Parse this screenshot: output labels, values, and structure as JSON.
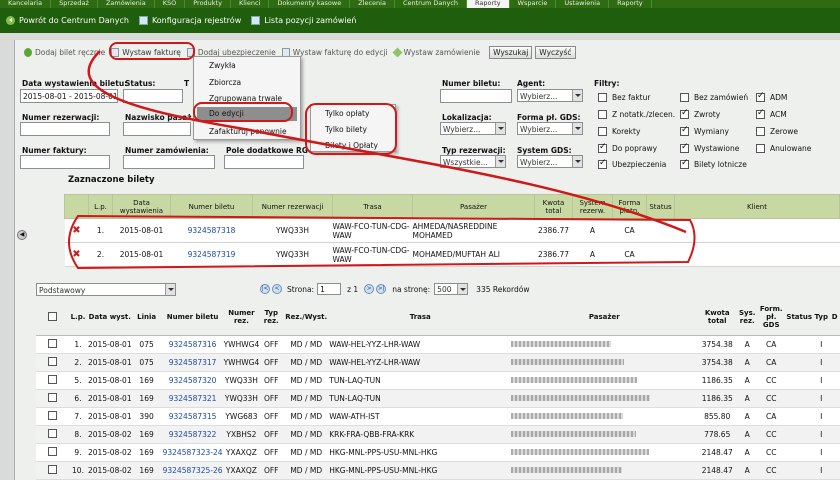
{
  "top_nav": {
    "tabs": [
      "Kancelaria",
      "Sprzedaż",
      "Zamówienia",
      "KSO",
      "Produkty",
      "Klienci",
      "Dokumenty kasowe",
      "Zlecenia",
      "Centrum Danych",
      "Raporty",
      "Wsparcie",
      "Ustawienia",
      "Raporty"
    ],
    "active_index": 9
  },
  "sub_nav": {
    "back": "Powrót do Centrum Danych",
    "config": "Konfiguracja rejestrów",
    "list": "Lista pozycji zamówień"
  },
  "toolbar": {
    "add_ticket": "Dodaj bilet ręcznie",
    "issue_invoice": "Wystaw fakturę",
    "add_insurance": "Dodaj ubezpieczenie",
    "issue_invoice_edit": "Wystaw fakturę do edycji",
    "issue_order": "Wystaw zamówienie",
    "search": "Wyszukaj",
    "clear": "Wyczyść"
  },
  "filters": {
    "issue_date_label": "Data wystawienia biletu:",
    "issue_date_value": "2015-08-01 - 2015-08-01",
    "status_label": "Status:",
    "t_label": "T",
    "ticket_number_label": "Numer biletu:",
    "agent_label": "Agent:",
    "agent_value": "Wybierz...",
    "reservation_label": "Numer rezerwacji:",
    "passenger_label": "Nazwisko pasaż",
    "location_label": "Lokalizacja:",
    "location_value": "Wybierz...",
    "gds_form_label": "Forma pł. GDS:",
    "gds_form_value": "Wybierz...",
    "invoice_label": "Numer faktury:",
    "order_label": "Numer zamówienia:",
    "extra_field_label": "Pole dodatkowe RG",
    "reservation_type_label": "Typ rezerwacji:",
    "reservation_type_value": "Wszystkie...",
    "gds_system_label": "System GDS:",
    "gds_system_value": "Wybierz..."
  },
  "checkbox_filters": {
    "title": "Filtry:",
    "items": [
      {
        "label": "Bez faktur",
        "checked": false
      },
      {
        "label": "Bez zamówień",
        "checked": false
      },
      {
        "label": "ADM",
        "checked": true
      },
      {
        "label": "Z notatk./zlecen.",
        "checked": false
      },
      {
        "label": "Zwroty",
        "checked": true
      },
      {
        "label": "ACM",
        "checked": true
      },
      {
        "label": "Korekty",
        "checked": false
      },
      {
        "label": "Wymiany",
        "checked": true
      },
      {
        "label": "Zerowe",
        "checked": false
      },
      {
        "label": "Do poprawy",
        "checked": true
      },
      {
        "label": "Wystawione",
        "checked": true
      },
      {
        "label": "Anulowane",
        "checked": false
      },
      {
        "label": "Ubezpieczenia",
        "checked": true
      },
      {
        "label": "Bilety lotnicze",
        "checked": true
      }
    ]
  },
  "dropdown_menu": {
    "items": [
      "Zwykła",
      "Zbiorcza",
      "Zgrupowana trwale",
      "Do edycji",
      "Zafakturuj ponownie"
    ],
    "highlighted": "Do edycji"
  },
  "submenu": {
    "items": [
      "Tylko opłaty",
      "Tylko bilety",
      "Bilety i Opłaty"
    ]
  },
  "selected": {
    "title": "Zaznaczone bilety",
    "headers": [
      "L.p.",
      "Data wystawienia",
      "Numer biletu",
      "Numer rezerwacji",
      "Trasa",
      "Pasażer",
      "Kwota total",
      "System rezerw.",
      "Forma płatn.",
      "Status",
      "Klient"
    ],
    "rows": [
      {
        "lp": "1.",
        "date": "2015-08-01",
        "ticket": "9324587318",
        "res": "YWQ33H",
        "route": "WAW-FCO-TUN-CDG-WAW",
        "passenger": "AHMEDA/NASREDDINE MOHAMED",
        "amount": "2386.77",
        "sys": "A",
        "form": "CA"
      },
      {
        "lp": "2.",
        "date": "2015-08-01",
        "ticket": "9324587319",
        "res": "YWQ33H",
        "route": "WAW-FCO-TUN-CDG-WAW",
        "passenger": "MOHAMED/MUFTAH ALI",
        "amount": "2386.77",
        "sys": "A",
        "form": "CA"
      }
    ]
  },
  "pager": {
    "view": "Podstawowy",
    "page_label": "Strona:",
    "page": "1",
    "of": "z 1",
    "per_page_label": "na stronę:",
    "per_page": "500",
    "records": "335 Rekordów"
  },
  "main_table": {
    "headers": [
      "L.p.",
      "Data wyst.",
      "Linia",
      "Numer biletu",
      "Numer rez.",
      "Typ rez.",
      "Rez./Wyst.",
      "Trasa",
      "Pasażer",
      "Kwota total",
      "Sys. rez.",
      "Form. pł. GDS",
      "Status",
      "Typ",
      "D"
    ],
    "rows": [
      {
        "lp": "1.",
        "date": "2015-08-01",
        "line": "075",
        "ticket": "9324587316",
        "res": "YWHWG4",
        "type": "OFF",
        "rw": "MD / MD",
        "route": "WAW-HEL-YYZ-LHR-WAW",
        "amount": "3754.38",
        "sys": "A",
        "form": "CA",
        "t": "I"
      },
      {
        "lp": "2.",
        "date": "2015-08-01",
        "line": "075",
        "ticket": "9324587317",
        "res": "YWHWG4",
        "type": "OFF",
        "rw": "MD / MD",
        "route": "WAW-HEL-YYZ-LHR-WAW",
        "amount": "3754.38",
        "sys": "A",
        "form": "CA",
        "t": "I"
      },
      {
        "lp": "5.",
        "date": "2015-08-01",
        "line": "169",
        "ticket": "9324587320",
        "res": "YWQ33H",
        "type": "OFF",
        "rw": "MD / MD",
        "route": "TUN-LAQ-TUN",
        "amount": "1186.35",
        "sys": "A",
        "form": "CC",
        "t": "I"
      },
      {
        "lp": "6.",
        "date": "2015-08-01",
        "line": "169",
        "ticket": "9324587321",
        "res": "YWQ33H",
        "type": "OFF",
        "rw": "MD / MD",
        "route": "TUN-LAQ-TUN",
        "amount": "1186.35",
        "sys": "A",
        "form": "CC",
        "t": "I"
      },
      {
        "lp": "7.",
        "date": "2015-08-01",
        "line": "390",
        "ticket": "9324587315",
        "res": "YWG683",
        "type": "OFF",
        "rw": "MD / MD",
        "route": "WAW-ATH-IST",
        "amount": "855.80",
        "sys": "A",
        "form": "CA",
        "t": "I"
      },
      {
        "lp": "8.",
        "date": "2015-08-02",
        "line": "169",
        "ticket": "9324587322",
        "res": "YXBHS2",
        "type": "OFF",
        "rw": "MD / MD",
        "route": "KRK-FRA-QBB-FRA-KRK",
        "amount": "778.65",
        "sys": "A",
        "form": "CC",
        "t": "I"
      },
      {
        "lp": "9.",
        "date": "2015-08-02",
        "line": "169",
        "ticket": "9324587323-24",
        "res": "YXAXQZ",
        "type": "OFF",
        "rw": "MD / MD",
        "route": "HKG-MNL-PPS-USU-MNL-HKG",
        "amount": "2148.47",
        "sys": "A",
        "form": "CC",
        "t": "I"
      },
      {
        "lp": "10.",
        "date": "2015-08-02",
        "line": "169",
        "ticket": "9324587325-26",
        "res": "YXAXQZ",
        "type": "OFF",
        "rw": "MD / MD",
        "route": "HKG-MNL-PPS-USU-MNL-HKG",
        "amount": "2148.47",
        "sys": "A",
        "form": "CC",
        "t": "I"
      }
    ]
  },
  "colors": {
    "nav_green": "#1f5e0c",
    "header_green": "#c8d8a2",
    "annotation_red": "#d01818",
    "link_blue": "#1a4aa8"
  },
  "icons": [
    "back-arrow-icon",
    "config-icon",
    "list-icon",
    "add-icon",
    "invoice-icon",
    "insurance-icon",
    "order-icon",
    "delete-icon",
    "page-first-icon",
    "page-prev-icon",
    "page-next-icon",
    "page-last-icon",
    "scroll-left-icon"
  ]
}
